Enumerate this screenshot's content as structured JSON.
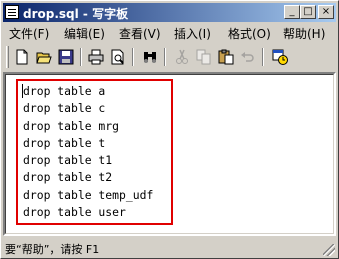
{
  "window": {
    "title": "drop.sql - 写字板",
    "buttons": {
      "minimize": "_",
      "maximize": "□",
      "close": "×"
    }
  },
  "menubar": {
    "items": [
      {
        "label": "文件(F)"
      },
      {
        "label": "编辑(E)"
      },
      {
        "label": "查看(V)"
      },
      {
        "label": "插入(I)"
      },
      {
        "label": "格式(O)"
      },
      {
        "label": "帮助(H)"
      }
    ]
  },
  "toolbar": {
    "buttons": [
      {
        "icon": "new-document-icon",
        "enabled": true
      },
      {
        "icon": "open-folder-icon",
        "enabled": true
      },
      {
        "icon": "save-disk-icon",
        "enabled": true
      },
      {
        "icon": "print-icon",
        "enabled": true
      },
      {
        "icon": "print-preview-icon",
        "enabled": true
      },
      {
        "icon": "find-binoculars-icon",
        "enabled": true
      },
      {
        "icon": "cut-scissors-icon",
        "enabled": false
      },
      {
        "icon": "copy-icon",
        "enabled": false
      },
      {
        "icon": "paste-icon",
        "enabled": true
      },
      {
        "icon": "undo-icon",
        "enabled": false
      },
      {
        "icon": "insert-date-time-icon",
        "enabled": true
      }
    ]
  },
  "document": {
    "lines": [
      "drop table a",
      "drop table c",
      "drop table mrg",
      "drop table t",
      "drop table t1",
      "drop table t2",
      "drop table temp_udf",
      "drop table user"
    ],
    "highlight_color": "#e00000"
  },
  "statusbar": {
    "text": "要“帮助”，请按 F1"
  }
}
